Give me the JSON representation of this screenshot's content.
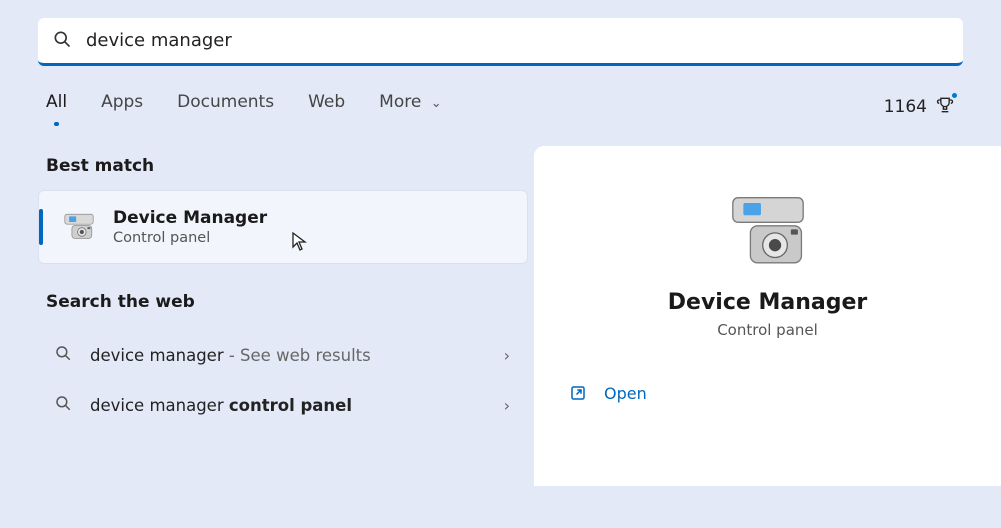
{
  "search": {
    "query": "device manager"
  },
  "tabs": {
    "items": [
      {
        "label": "All",
        "active": true
      },
      {
        "label": "Apps",
        "active": false
      },
      {
        "label": "Documents",
        "active": false
      },
      {
        "label": "Web",
        "active": false
      },
      {
        "label": "More",
        "active": false,
        "dropdown": true
      }
    ]
  },
  "points": {
    "value": "1164"
  },
  "sections": {
    "best_match_label": "Best match",
    "search_web_label": "Search the web"
  },
  "best_match": {
    "title": "Device Manager",
    "subtitle": "Control panel"
  },
  "web_results": [
    {
      "prefix": "device manager",
      "hint": " - See web results",
      "bold": ""
    },
    {
      "prefix": "device manager ",
      "hint": "",
      "bold": "control panel"
    }
  ],
  "preview": {
    "title": "Device Manager",
    "subtitle": "Control panel",
    "open_label": "Open"
  }
}
